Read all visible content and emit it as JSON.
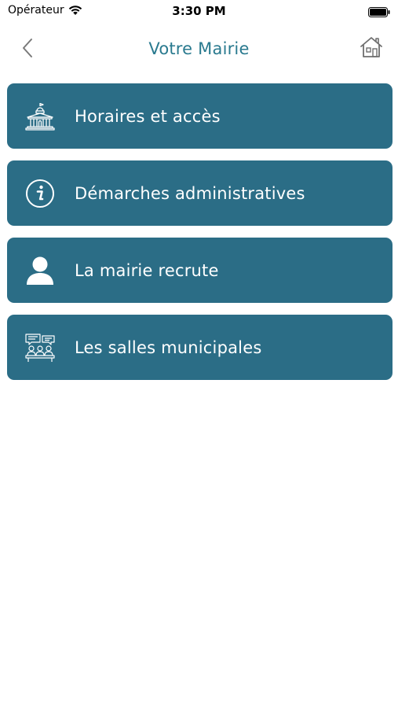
{
  "status_bar": {
    "carrier": "Opérateur",
    "time": "3:30 PM"
  },
  "nav": {
    "title": "Votre Mairie",
    "back_icon": "chevron-left-icon",
    "home_icon": "home-icon"
  },
  "menu": {
    "items": [
      {
        "label": "Horaires et accès",
        "icon": "town-hall-icon"
      },
      {
        "label": "Démarches administratives",
        "icon": "info-icon"
      },
      {
        "label": "La mairie recrute",
        "icon": "person-icon"
      },
      {
        "label": "Les salles municipales",
        "icon": "meeting-room-icon"
      }
    ]
  },
  "colors": {
    "accent": "#2a7a8f",
    "tile": "#2b6d86",
    "tile_text": "#ffffff"
  }
}
